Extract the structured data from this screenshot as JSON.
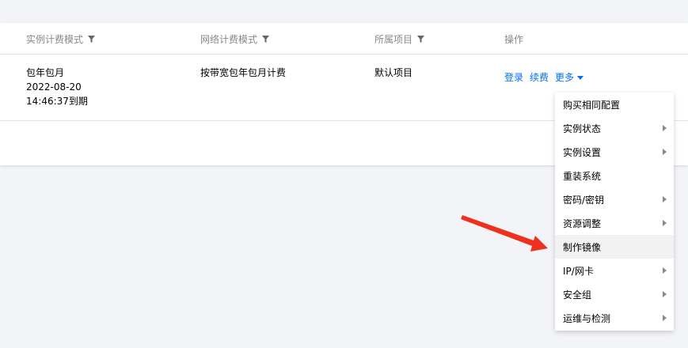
{
  "table": {
    "columns": [
      {
        "label": "实例计费模式",
        "filter": true
      },
      {
        "label": "网络计费模式",
        "filter": true
      },
      {
        "label": "所属项目",
        "filter": true
      },
      {
        "label": "操作",
        "filter": false
      }
    ],
    "row": {
      "billing_mode": [
        "包年包月",
        "2022-08-20",
        "14:46:37到期"
      ],
      "network_billing": "按带宽包年包月计费",
      "project": "默认项目",
      "actions": {
        "login": "登录",
        "renew": "续费",
        "more": "更多"
      }
    }
  },
  "menu": {
    "items": [
      {
        "label": "购买相同配置",
        "submenu": false
      },
      {
        "label": "实例状态",
        "submenu": true
      },
      {
        "label": "实例设置",
        "submenu": true
      },
      {
        "label": "重装系统",
        "submenu": false
      },
      {
        "label": "密码/密钥",
        "submenu": true
      },
      {
        "label": "资源调整",
        "submenu": true
      },
      {
        "label": "制作镜像",
        "submenu": false,
        "highlighted": true
      },
      {
        "label": "IP/网卡",
        "submenu": true
      },
      {
        "label": "安全组",
        "submenu": true
      },
      {
        "label": "运维与检测",
        "submenu": true
      }
    ]
  },
  "colors": {
    "link": "#006eff",
    "annotation_arrow": "#f0301e",
    "highlight": "#f2f2f2"
  }
}
